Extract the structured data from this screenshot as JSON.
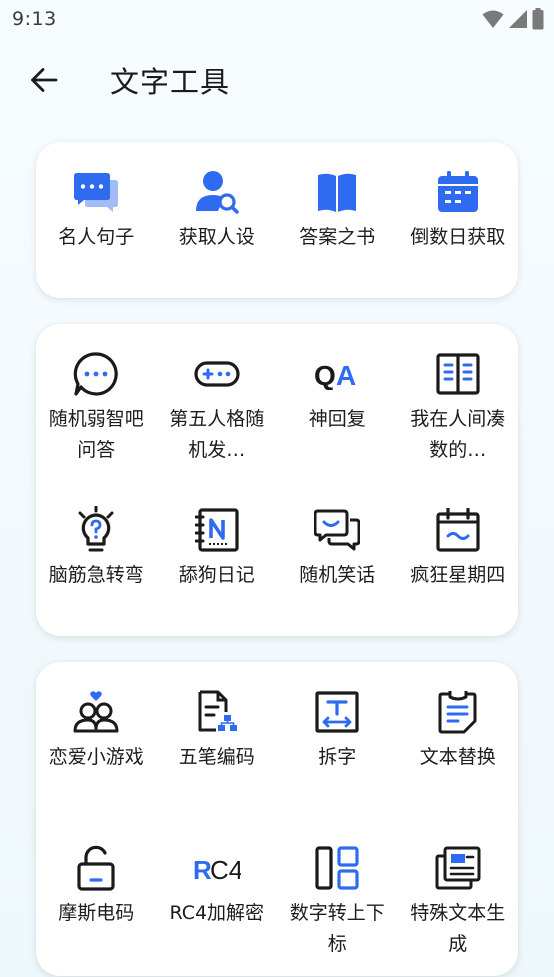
{
  "status_bar": {
    "time": "9:13"
  },
  "app_bar": {
    "title": "文字工具"
  },
  "colors": {
    "accent": "#2f6bf0",
    "ink": "#1a1a1a",
    "card": "#ffffff"
  },
  "sections": [
    {
      "items": [
        {
          "label": "名人句子",
          "icon": "chat-bubbles-icon"
        },
        {
          "label": "获取人设",
          "icon": "user-search-icon"
        },
        {
          "label": "答案之书",
          "icon": "book-icon"
        },
        {
          "label": "倒数日获取",
          "icon": "calendar-icon"
        }
      ]
    },
    {
      "items": [
        {
          "label": "随机弱智吧问答",
          "icon": "chat-dots-icon"
        },
        {
          "label": "第五人格随机发…",
          "icon": "gamepad-icon"
        },
        {
          "label": "神回复",
          "icon": "qa-icon"
        },
        {
          "label": "我在人间凑数的…",
          "icon": "open-book-icon"
        },
        {
          "label": "脑筋急转弯",
          "icon": "lightbulb-question-icon"
        },
        {
          "label": "舔狗日记",
          "icon": "notebook-n-icon"
        },
        {
          "label": "随机笑话",
          "icon": "smile-chat-icon"
        },
        {
          "label": "疯狂星期四",
          "icon": "calendar-wave-icon"
        }
      ]
    },
    {
      "items": [
        {
          "label": "恋爱小游戏",
          "icon": "couple-heart-icon"
        },
        {
          "label": "五笔编码",
          "icon": "document-code-icon"
        },
        {
          "label": "拆字",
          "icon": "text-split-icon"
        },
        {
          "label": "文本替换",
          "icon": "clipboard-text-icon"
        },
        {
          "label": "摩斯电码",
          "icon": "unlock-icon"
        },
        {
          "label": "RC4加解密",
          "icon": "rc4-icon"
        },
        {
          "label": "数字转上下标",
          "icon": "layout-icon"
        },
        {
          "label": "特殊文本生成",
          "icon": "copy-text-icon"
        }
      ]
    }
  ],
  "rc4_glyph": {
    "r": "R",
    "c4": "C4"
  },
  "qa_glyph": {
    "q": "Q",
    "a": "A"
  }
}
